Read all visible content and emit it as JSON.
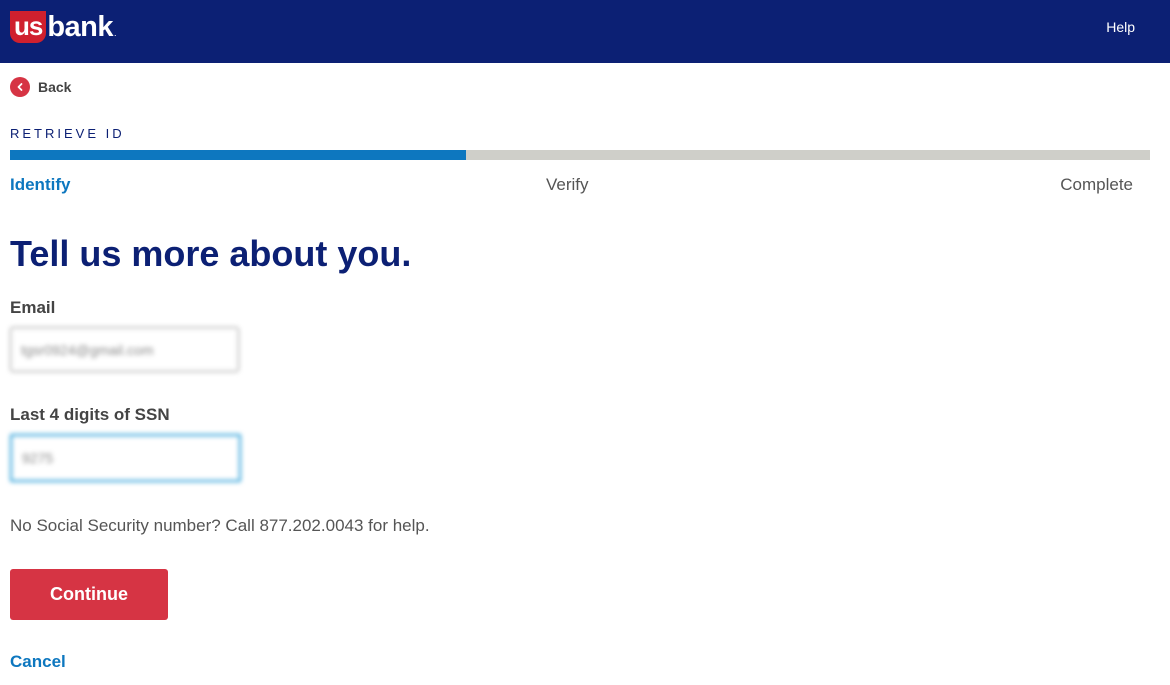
{
  "header": {
    "logo_us": "us",
    "logo_bank": "bank",
    "logo_mark": ".",
    "help_label": "Help"
  },
  "nav": {
    "back_label": "Back"
  },
  "flow": {
    "title": "RETRIEVE ID",
    "progress_fraction": 0.4,
    "steps": [
      {
        "label": "Identify",
        "active": true
      },
      {
        "label": "Verify",
        "active": false
      },
      {
        "label": "Complete",
        "active": false
      }
    ]
  },
  "form": {
    "heading": "Tell us more about you.",
    "email_label": "Email",
    "email_value": "tgsr0924@gmail.com",
    "ssn_label": "Last 4 digits of SSN",
    "ssn_value": "9275",
    "help_text": "No Social Security number? Call 877.202.0043 for help.",
    "continue_label": "Continue",
    "cancel_label": "Cancel"
  },
  "colors": {
    "header_bg": "#0c2074",
    "accent_red": "#d63444",
    "accent_blue": "#0d77bf",
    "progress_track": "#cfcfc9"
  },
  "icons": {
    "back": "chevron-left-icon",
    "logo": "usbank-logo"
  }
}
